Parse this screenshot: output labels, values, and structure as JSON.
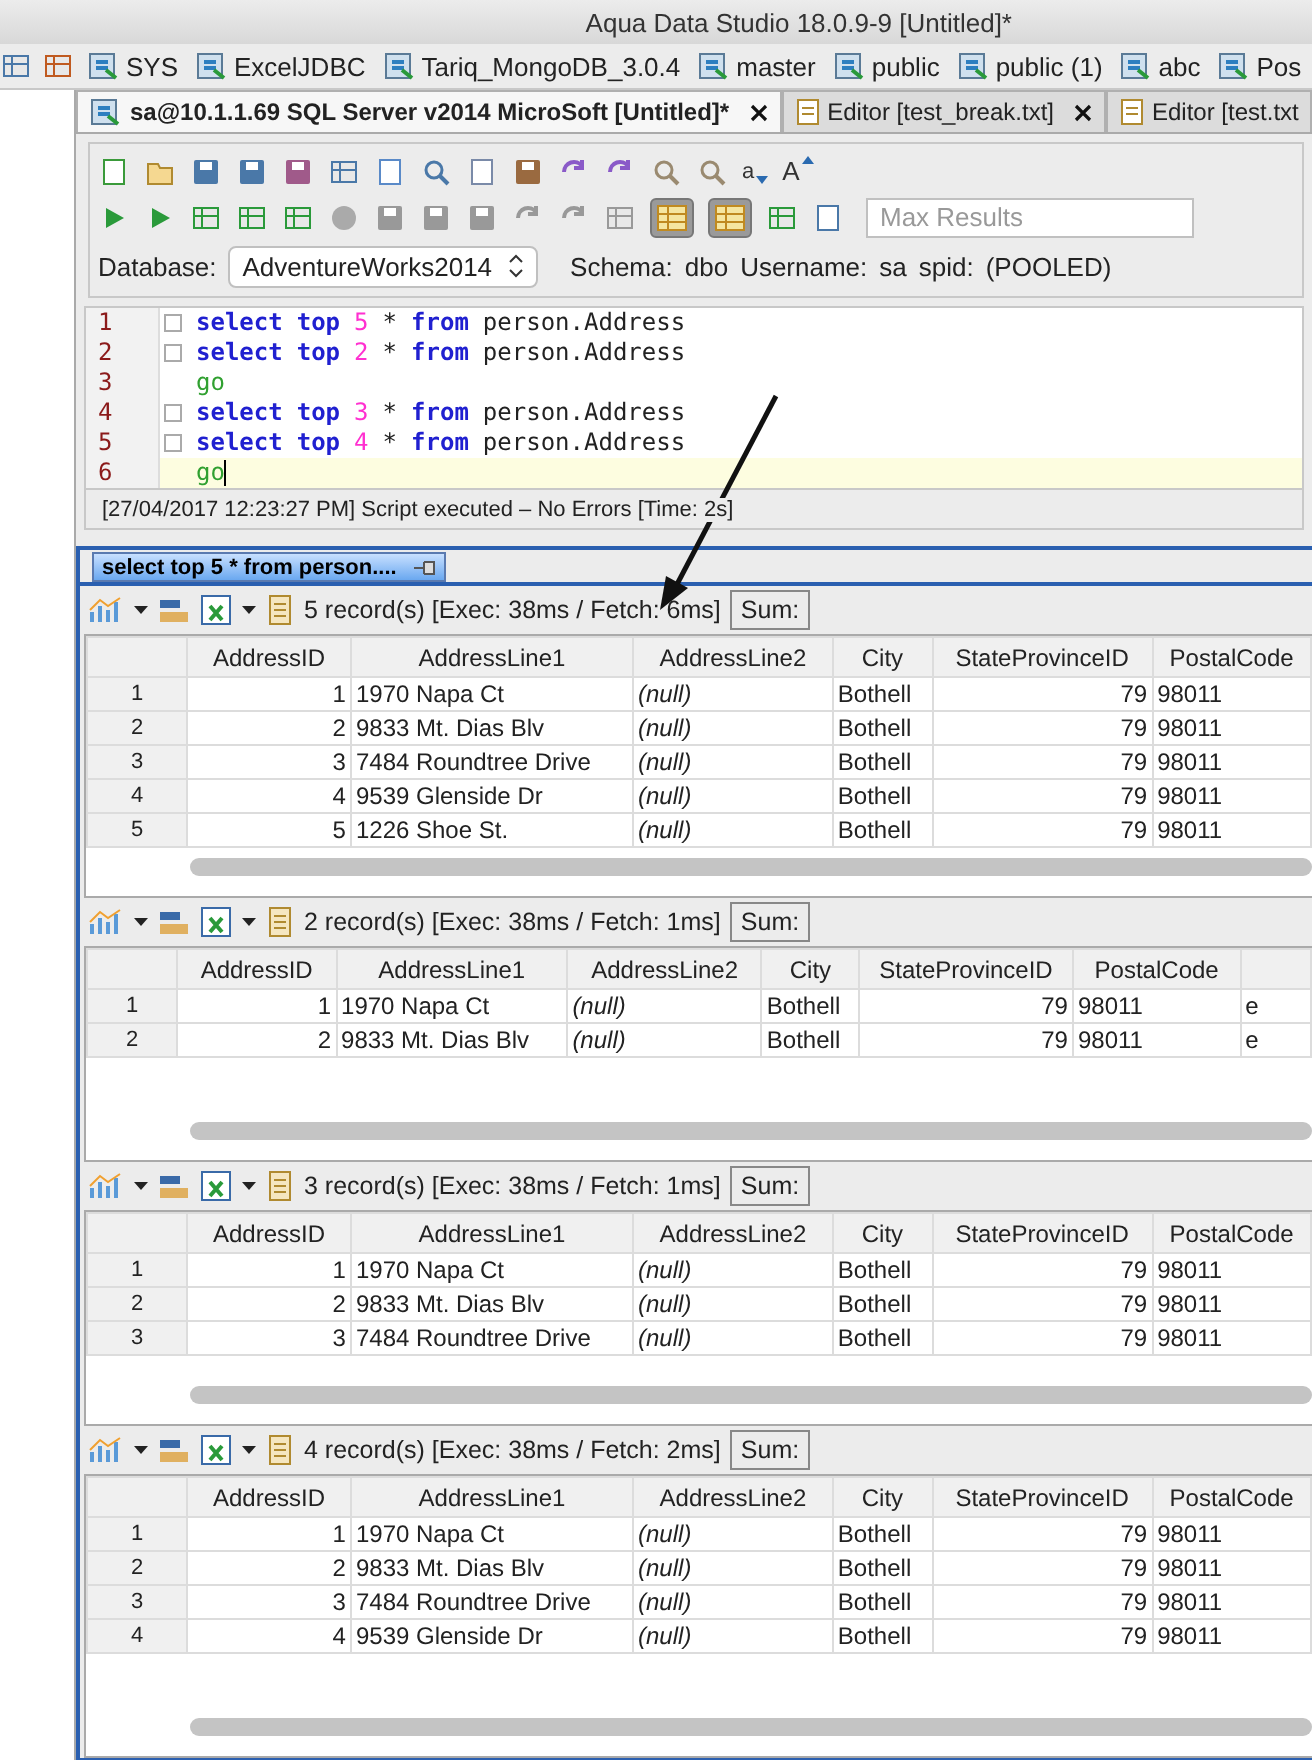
{
  "window": {
    "title": "Aqua Data Studio 18.0.9-9 [Untitled]*"
  },
  "connections": [
    {
      "label": "SYS"
    },
    {
      "label": "ExcelJDBC"
    },
    {
      "label": "Tariq_MongoDB_3.0.4"
    },
    {
      "label": "master"
    },
    {
      "label": "public"
    },
    {
      "label": "public (1)"
    },
    {
      "label": "abc"
    },
    {
      "label": "Pos"
    }
  ],
  "editor_tabs": [
    {
      "label": "sa@10.1.1.69 SQL Server v2014 MicroSoft [Untitled]*",
      "selected": true,
      "kind": "query",
      "closable": true
    },
    {
      "label": "Editor [test_break.txt]",
      "selected": false,
      "kind": "file",
      "closable": true
    },
    {
      "label": "Editor [test.txt",
      "selected": false,
      "kind": "file",
      "closable": false
    }
  ],
  "font_buttons": [
    {
      "label": "a"
    },
    {
      "label": "A"
    }
  ],
  "grid_toggles": [
    {
      "selected": true
    },
    {
      "selected": true
    }
  ],
  "max_results": {
    "placeholder": "Max Results"
  },
  "connection_info": {
    "database_label": "Database:",
    "database": "AdventureWorks2014",
    "schema_label": "Schema:",
    "schema": "dbo",
    "username_label": "Username:",
    "username": "sa",
    "spid_label": "spid:",
    "spid": "(POOLED)"
  },
  "editor": {
    "lines": [
      {
        "number": "1",
        "current": false,
        "fold": true,
        "tokens": [
          {
            "kind": "keyword",
            "text": "select"
          },
          {
            "kind": "keyword",
            "text": "top"
          },
          {
            "kind": "number",
            "text": "5"
          },
          {
            "kind": "plain",
            "text": "*"
          },
          {
            "kind": "keyword",
            "text": "from"
          },
          {
            "kind": "plain",
            "text": "person.Address"
          }
        ]
      },
      {
        "number": "2",
        "current": false,
        "fold": true,
        "tokens": [
          {
            "kind": "keyword",
            "text": "select"
          },
          {
            "kind": "keyword",
            "text": "top"
          },
          {
            "kind": "number",
            "text": "2"
          },
          {
            "kind": "plain",
            "text": "*"
          },
          {
            "kind": "keyword",
            "text": "from"
          },
          {
            "kind": "plain",
            "text": "person.Address"
          }
        ]
      },
      {
        "number": "3",
        "current": false,
        "fold": false,
        "tokens": [
          {
            "kind": "go",
            "text": "go"
          }
        ]
      },
      {
        "number": "4",
        "current": false,
        "fold": true,
        "tokens": [
          {
            "kind": "keyword",
            "text": "select"
          },
          {
            "kind": "keyword",
            "text": "top"
          },
          {
            "kind": "number",
            "text": "3"
          },
          {
            "kind": "plain",
            "text": "*"
          },
          {
            "kind": "keyword",
            "text": "from"
          },
          {
            "kind": "plain",
            "text": "person.Address"
          }
        ]
      },
      {
        "number": "5",
        "current": false,
        "fold": true,
        "tokens": [
          {
            "kind": "keyword",
            "text": "select"
          },
          {
            "kind": "keyword",
            "text": "top"
          },
          {
            "kind": "number",
            "text": "4"
          },
          {
            "kind": "plain",
            "text": "*"
          },
          {
            "kind": "keyword",
            "text": "from"
          },
          {
            "kind": "plain",
            "text": "person.Address"
          }
        ]
      },
      {
        "number": "6",
        "current": true,
        "fold": false,
        "tokens": [
          {
            "kind": "go",
            "text": "go"
          }
        ]
      }
    ]
  },
  "status": "[27/04/2017 12:23:27 PM] Script executed – No Errors [Time: 2s]",
  "result_tabs": [
    {
      "label": "select top 5 * from person....",
      "selected": true
    }
  ],
  "result_sets": [
    {
      "summary": "5 record(s) [Exec: 38ms  / Fetch: 6ms]",
      "sum_label": "Sum:",
      "columns": [
        {
          "label": "AddressID",
          "numeric": true
        },
        {
          "label": "AddressLine1",
          "numeric": false
        },
        {
          "label": "AddressLine2",
          "numeric": false
        },
        {
          "label": "City",
          "numeric": false
        },
        {
          "label": "StateProvinceID",
          "numeric": true
        },
        {
          "label": "PostalCode",
          "numeric": false
        }
      ],
      "rows": [
        {
          "number": "1",
          "cells": [
            "1",
            "1970 Napa Ct",
            {
              "value": "(null)",
              "is_null": true
            },
            "Bothell",
            "79",
            "98011"
          ]
        },
        {
          "number": "2",
          "cells": [
            "2",
            "9833 Mt. Dias Blv",
            {
              "value": "(null)",
              "is_null": true
            },
            "Bothell",
            "79",
            "98011"
          ]
        },
        {
          "number": "3",
          "cells": [
            "3",
            "7484 Roundtree Drive",
            {
              "value": "(null)",
              "is_null": true
            },
            "Bothell",
            "79",
            "98011"
          ]
        },
        {
          "number": "4",
          "cells": [
            "4",
            "9539 Glenside Dr",
            {
              "value": "(null)",
              "is_null": true
            },
            "Bothell",
            "79",
            "98011"
          ]
        },
        {
          "number": "5",
          "cells": [
            "5",
            "1226 Shoe St.",
            {
              "value": "(null)",
              "is_null": true
            },
            "Bothell",
            "79",
            "98011"
          ]
        }
      ]
    },
    {
      "summary": "2 record(s) [Exec: 38ms  / Fetch: 1ms]",
      "sum_label": "Sum:",
      "columns": [
        {
          "label": "AddressID",
          "numeric": true
        },
        {
          "label": "AddressLine1",
          "numeric": false
        },
        {
          "label": "AddressLine2",
          "numeric": false
        },
        {
          "label": "City",
          "numeric": false
        },
        {
          "label": "StateProvinceID",
          "numeric": true
        },
        {
          "label": "PostalCode",
          "numeric": false
        }
      ],
      "rows": [
        {
          "number": "1",
          "cells": [
            "1",
            "1970 Napa Ct",
            {
              "value": "(null)",
              "is_null": true
            },
            "Bothell",
            "79",
            "98011",
            "e"
          ]
        },
        {
          "number": "2",
          "cells": [
            "2",
            "9833 Mt. Dias Blv",
            {
              "value": "(null)",
              "is_null": true
            },
            "Bothell",
            "79",
            "98011",
            "e"
          ]
        }
      ]
    },
    {
      "summary": "3 record(s) [Exec: 38ms  / Fetch: 1ms]",
      "sum_label": "Sum:",
      "columns": [
        {
          "label": "AddressID",
          "numeric": true
        },
        {
          "label": "AddressLine1",
          "numeric": false
        },
        {
          "label": "AddressLine2",
          "numeric": false
        },
        {
          "label": "City",
          "numeric": false
        },
        {
          "label": "StateProvinceID",
          "numeric": true
        },
        {
          "label": "PostalCode",
          "numeric": false
        }
      ],
      "rows": [
        {
          "number": "1",
          "cells": [
            "1",
            "1970 Napa Ct",
            {
              "value": "(null)",
              "is_null": true
            },
            "Bothell",
            "79",
            "98011"
          ]
        },
        {
          "number": "2",
          "cells": [
            "2",
            "9833 Mt. Dias Blv",
            {
              "value": "(null)",
              "is_null": true
            },
            "Bothell",
            "79",
            "98011"
          ]
        },
        {
          "number": "3",
          "cells": [
            "3",
            "7484 Roundtree Drive",
            {
              "value": "(null)",
              "is_null": true
            },
            "Bothell",
            "79",
            "98011"
          ]
        }
      ]
    },
    {
      "summary": "4 record(s) [Exec: 38ms  / Fetch: 2ms]",
      "sum_label": "Sum:",
      "columns": [
        {
          "label": "AddressID",
          "numeric": true
        },
        {
          "label": "AddressLine1",
          "numeric": false
        },
        {
          "label": "AddressLine2",
          "numeric": false
        },
        {
          "label": "City",
          "numeric": false
        },
        {
          "label": "StateProvinceID",
          "numeric": true
        },
        {
          "label": "PostalCode",
          "numeric": false
        }
      ],
      "rows": [
        {
          "number": "1",
          "cells": [
            "1",
            "1970 Napa Ct",
            {
              "value": "(null)",
              "is_null": true
            },
            "Bothell",
            "79",
            "98011"
          ]
        },
        {
          "number": "2",
          "cells": [
            "2",
            "9833 Mt. Dias Blv",
            {
              "value": "(null)",
              "is_null": true
            },
            "Bothell",
            "79",
            "98011"
          ]
        },
        {
          "number": "3",
          "cells": [
            "3",
            "7484 Roundtree Drive",
            {
              "value": "(null)",
              "is_null": true
            },
            "Bothell",
            "79",
            "98011"
          ]
        },
        {
          "number": "4",
          "cells": [
            "4",
            "9539 Glenside Dr",
            {
              "value": "(null)",
              "is_null": true
            },
            "Bothell",
            "79",
            "98011"
          ]
        }
      ]
    }
  ]
}
